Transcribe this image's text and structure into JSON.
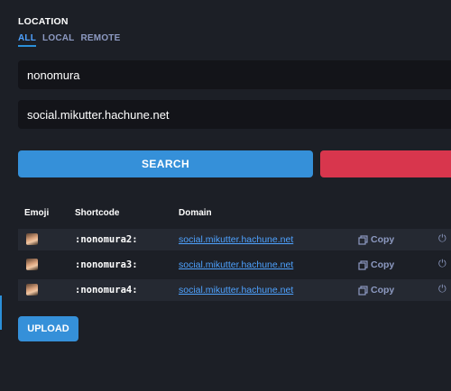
{
  "location": {
    "label": "LOCATION",
    "filters": [
      "ALL",
      "LOCAL",
      "REMOTE"
    ]
  },
  "search": {
    "shortcode_value": "nonomura",
    "domain_value": "social.mikutter.hachune.net",
    "search_label": "SEARCH",
    "danger_label": ""
  },
  "table": {
    "headers": {
      "emoji": "Emoji",
      "shortcode": "Shortcode",
      "domain": "Domain"
    },
    "rows": [
      {
        "shortcode": ":nonomura2:",
        "domain": "social.mikutter.hachune.net",
        "copy_label": "Copy"
      },
      {
        "shortcode": ":nonomura3:",
        "domain": "social.mikutter.hachune.net",
        "copy_label": "Copy"
      },
      {
        "shortcode": ":nonomura4:",
        "domain": "social.mikutter.hachune.net",
        "copy_label": "Copy"
      }
    ]
  },
  "upload_label": "UPLOAD",
  "colors": {
    "background": "#1c1f26",
    "accent": "#3590d9",
    "danger": "#d8364d",
    "link": "#4ea2ff"
  },
  "icons": {
    "copy": "copy-icon",
    "power": "power-icon"
  }
}
